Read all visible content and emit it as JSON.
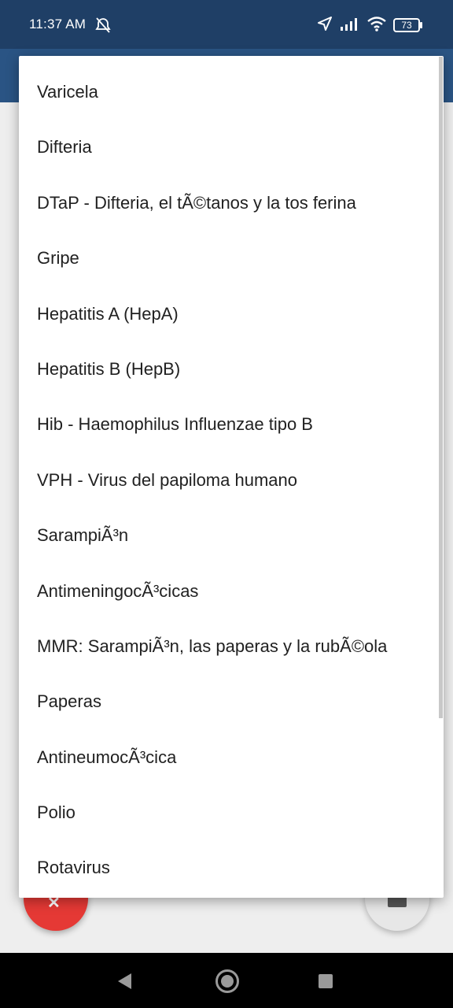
{
  "status_bar": {
    "time": "11:37 AM",
    "battery": "73",
    "icons": [
      "alarm-off-icon",
      "location-arrow-icon",
      "signal-icon",
      "wifi-icon",
      "battery-icon"
    ]
  },
  "dropdown": {
    "items": [
      "Varicela",
      "Difteria",
      "DTaP - Difteria, el tÃ©tanos y la tos ferina",
      "Gripe",
      "Hepatitis A (HepA)",
      "Hepatitis B (HepB)",
      "Hib - Haemophilus Influenzae tipo B",
      "VPH - Virus del papiloma humano",
      "SarampiÃ³n",
      "AntimeningocÃ³cicas",
      "MMR: SarampiÃ³n, las paperas y la rubÃ©ola",
      "Paperas",
      "AntineumocÃ³cica",
      "Polio",
      "Rotavirus"
    ]
  },
  "colors": {
    "status_bar": "#1f3f66",
    "app_bar": "#2a5484",
    "fab_left": "#e53935"
  }
}
